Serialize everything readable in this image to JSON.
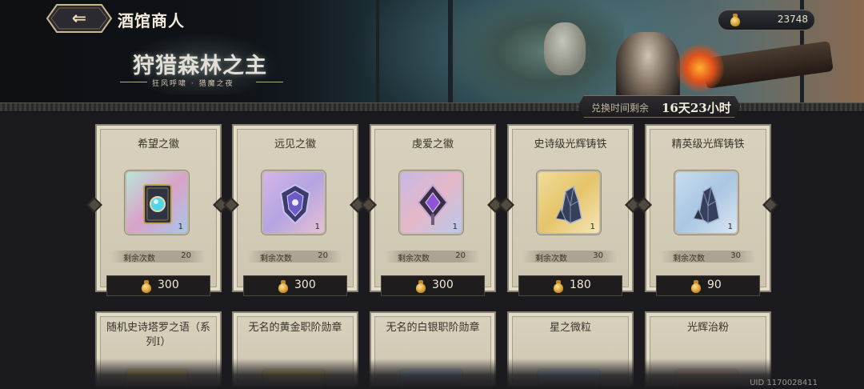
{
  "header": {
    "shop_title": "酒馆商人",
    "event_title": "狩猎森林之主",
    "event_subtitle": "狂风呼啸 · 猎魔之夜",
    "currency_amount": "23748",
    "currency_icon": "coin-pouch-icon"
  },
  "timer": {
    "label": "兑换时间剩余",
    "value": "16天23小时"
  },
  "cards": [
    {
      "name": "希望之徽",
      "remain_label": "剩余次数",
      "remain": "20",
      "price": "300",
      "qty": "1",
      "icon": "tome-orb-icon",
      "bg": [
        "#b9e6d8",
        "#d9a2c9",
        "#a7c7e8"
      ]
    },
    {
      "name": "远见之徽",
      "remain_label": "剩余次数",
      "remain": "20",
      "price": "300",
      "qty": "1",
      "icon": "crest-shield-icon",
      "bg": [
        "#d6b6e6",
        "#b4a4e2",
        "#e7c0d2"
      ]
    },
    {
      "name": "虔爱之徽",
      "remain_label": "剩余次数",
      "remain": "20",
      "price": "300",
      "qty": "1",
      "icon": "amulet-pendant-icon",
      "bg": [
        "#c7b7e6",
        "#e5b8c8",
        "#b8c8ec"
      ]
    },
    {
      "name": "史诗级光辉铸铁",
      "remain_label": "剩余次数",
      "remain": "30",
      "price": "180",
      "qty": "1",
      "icon": "crystal-ore-icon",
      "bg": [
        "#f0dc9a",
        "#e5c46a",
        "#f6e6b8"
      ]
    },
    {
      "name": "精英级光辉铸铁",
      "remain_label": "剩余次数",
      "remain": "30",
      "price": "90",
      "qty": "1",
      "icon": "crystal-ore-icon",
      "bg": [
        "#c8dcee",
        "#a9c6e2",
        "#dbe6f2"
      ]
    }
  ],
  "cards_row2": [
    {
      "name": "随机史诗塔罗之语（系列Ⅰ）",
      "bg": "#e4c46c"
    },
    {
      "name": "无名的黄金职阶勋章",
      "bg": "#e4c46c"
    },
    {
      "name": "无名的白银职阶勋章",
      "bg": "#a9c6e2"
    },
    {
      "name": "星之微粒",
      "bg": "#a9c6e2"
    },
    {
      "name": "光辉治粉",
      "bg": "#d9b3a3"
    }
  ],
  "footer": {
    "uid": "UID 1170028411"
  }
}
